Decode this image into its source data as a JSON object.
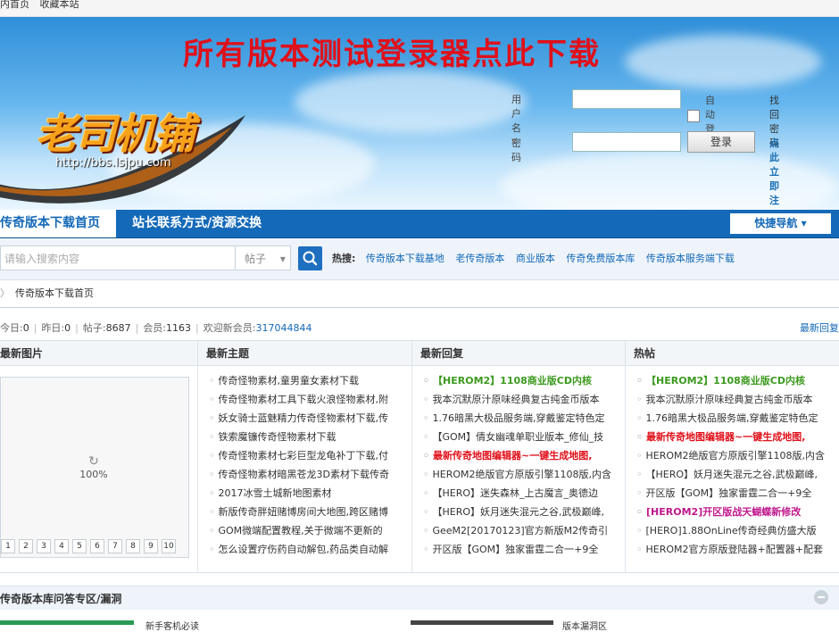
{
  "topbar": {
    "home": "内首页",
    "favorite": "收藏本站"
  },
  "banner": {
    "title": "所有版本测试登录器点此下载",
    "logo_text": "老司机铺",
    "logo_url": "http://bbs.lsjpu.com"
  },
  "login": {
    "username_label": "用户名",
    "password_label": "密码",
    "auto_login": "自动登录",
    "login_button": "登录",
    "find_password": "找回密码",
    "register": "点此立即注册"
  },
  "nav": {
    "active_tab": "传奇版本下载首页",
    "tab2": "站长联系方式/资源交换",
    "quick_nav": "快捷导航"
  },
  "search": {
    "placeholder": "请输入搜索内容",
    "type": "帖子",
    "hot_label": "热搜:",
    "hot_links": [
      "传奇版本下载基地",
      "老传奇版本",
      "商业版本",
      "传奇免费版本库",
      "传奇版本服务端下载"
    ]
  },
  "breadcrumb": {
    "current": "传奇版本下载首页"
  },
  "stats": {
    "today_label": "今日:",
    "today": "0",
    "yesterday_label": "昨日:",
    "yesterday": "0",
    "posts_label": "帖子:",
    "posts": "8687",
    "members_label": "会员:",
    "members": "1163",
    "welcome_label": "欢迎新会员:",
    "new_member": "317044844",
    "latest_reply": "最新回复"
  },
  "columns": {
    "images": {
      "title": "最新图片",
      "loading": "100%",
      "pages": [
        "1",
        "2",
        "3",
        "4",
        "5",
        "6",
        "7",
        "8",
        "9",
        "10"
      ]
    },
    "threads": {
      "title": "最新主题",
      "items": [
        {
          "text": "传奇怪物素材,童男童女素材下载",
          "style": ""
        },
        {
          "text": "传奇怪物素材工具下载火浪怪物素材,附",
          "style": ""
        },
        {
          "text": "妖女骑士蓝魅精力传奇怪物素材下载,传",
          "style": ""
        },
        {
          "text": "铁索魔镰传奇怪物素材下载",
          "style": ""
        },
        {
          "text": "传奇怪物素材七彩巨型龙龟补丁下载,付",
          "style": ""
        },
        {
          "text": "传奇怪物素材暗黑苍龙3D素材下载传奇",
          "style": ""
        },
        {
          "text": "2017冰雪土城新地图素材",
          "style": ""
        },
        {
          "text": "新版传奇胖妞赌博房间大地图,跨区赌博",
          "style": ""
        },
        {
          "text": "GOM微端配置教程,关于微端不更新的",
          "style": ""
        },
        {
          "text": "怎么设置疗伤药自动解包,药品类自动解",
          "style": ""
        }
      ]
    },
    "replies": {
      "title": "最新回复",
      "items": [
        {
          "text": "【HEROM2】1108商业版CD内核",
          "style": "green"
        },
        {
          "text": "我本沉默原汁原味经典复古纯金币版本",
          "style": ""
        },
        {
          "text": "1.76暗黑大极品服务端,穿戴鉴定特色定",
          "style": ""
        },
        {
          "text": "【GOM】倩女幽魂单职业版本_修仙_技",
          "style": ""
        },
        {
          "text": "最新传奇地图编辑器~一键生成地图,",
          "style": "red"
        },
        {
          "text": "HEROM2绝版官方原版引擎1108版,内含",
          "style": ""
        },
        {
          "text": "【HERO】迷失森林_上古魔言_奥德边",
          "style": ""
        },
        {
          "text": "【HERO】妖月迷失混元之谷,武极巅峰,",
          "style": ""
        },
        {
          "text": "GeeM2[20170123]官方新版M2传奇引",
          "style": ""
        },
        {
          "text": "开区版【GOM】独家雷霆二合一+9全",
          "style": ""
        }
      ]
    },
    "hot": {
      "title": "热帖",
      "items": [
        {
          "text": "【HEROM2】1108商业版CD内核",
          "style": "green"
        },
        {
          "text": "我本沉默原汁原味经典复古纯金币版本",
          "style": ""
        },
        {
          "text": "1.76暗黑大极品服务端,穿戴鉴定特色定",
          "style": ""
        },
        {
          "text": "最新传奇地图编辑器~一键生成地图,",
          "style": "red"
        },
        {
          "text": "HEROM2绝版官方原版引擎1108版,内含",
          "style": ""
        },
        {
          "text": "【HERO】妖月迷失混元之谷,武极巅峰,",
          "style": ""
        },
        {
          "text": "开区版【GOM】独家雷霆二合一+9全",
          "style": ""
        },
        {
          "text": "[HEROM2]开区版战天蝴蝶新修改",
          "style": "purple"
        },
        {
          "text": "[HERO]1.88OnLine传奇经典仿盛大版",
          "style": ""
        },
        {
          "text": "HEROM2官方原版登陆器+配置器+配套",
          "style": ""
        }
      ]
    }
  },
  "qa": {
    "title": "传奇版本库问答专区/漏洞"
  },
  "bottom": {
    "left_text": "新手客机必读",
    "right_text": "版本漏洞区"
  }
}
